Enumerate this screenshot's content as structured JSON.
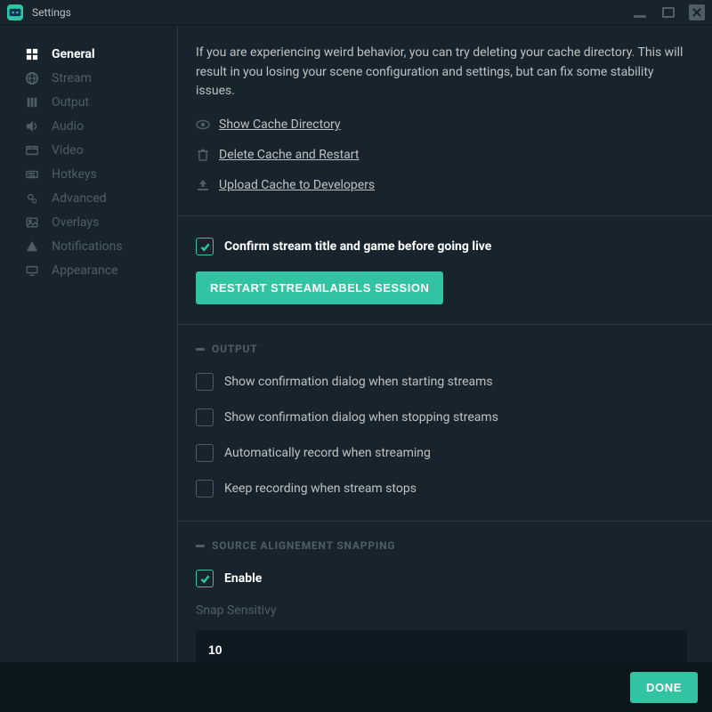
{
  "window": {
    "title": "Settings"
  },
  "sidebar": {
    "items": [
      {
        "label": "General"
      },
      {
        "label": "Stream"
      },
      {
        "label": "Output"
      },
      {
        "label": "Audio"
      },
      {
        "label": "Video"
      },
      {
        "label": "Hotkeys"
      },
      {
        "label": "Advanced"
      },
      {
        "label": "Overlays"
      },
      {
        "label": "Notifications"
      },
      {
        "label": "Appearance"
      }
    ]
  },
  "cache": {
    "intro": "If you are experiencing weird behavior, you can try deleting your cache directory. This will result in you losing your scene configuration and settings, but can fix some stability issues.",
    "show": "Show Cache Directory",
    "delete": "Delete Cache and Restart",
    "upload": "Upload Cache to Developers"
  },
  "confirm": {
    "label": "Confirm stream title and game before going live",
    "restart_btn": "Restart Streamlabels Session"
  },
  "output": {
    "header": "Output",
    "opt1": "Show confirmation dialog when starting streams",
    "opt2": "Show confirmation dialog when stopping streams",
    "opt3": "Automatically record when streaming",
    "opt4": "Keep recording when stream stops"
  },
  "snapping": {
    "header": "Source Alignement Snapping",
    "enable": "Enable",
    "sens_label": "Snap Sensitivy",
    "sens_value": "10"
  },
  "footer": {
    "done": "Done"
  }
}
